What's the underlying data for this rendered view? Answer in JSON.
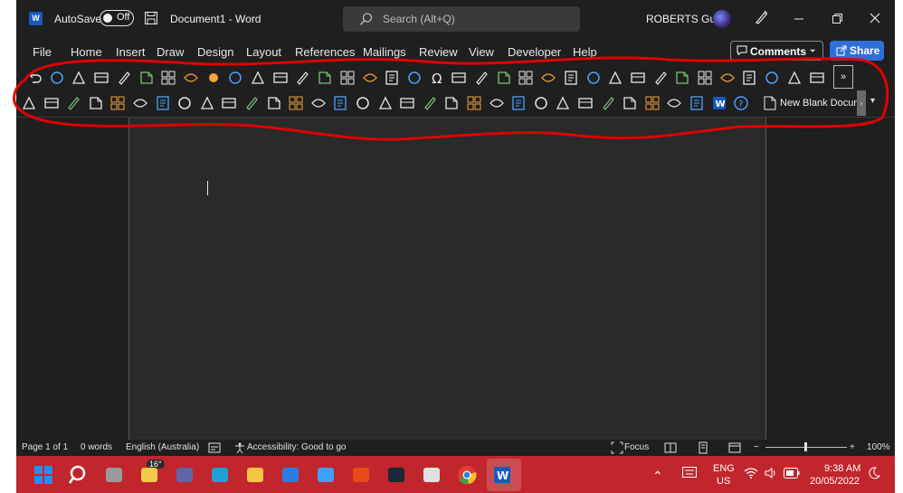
{
  "title_bar": {
    "app_logo_letter": "W",
    "autosave_label": "AutoSave",
    "autosave_state": "Off",
    "document_title": "Document1 - Word",
    "search_placeholder": "Search (Alt+Q)",
    "user_name": "ROBERTS Guy"
  },
  "ribbon_tabs": [
    "File",
    "Home",
    "Insert",
    "Draw",
    "Design",
    "Layout",
    "References",
    "Mailings",
    "Review",
    "View",
    "Developer",
    "Help"
  ],
  "comments_label": "Comments",
  "share_label": "Share",
  "toolbar": {
    "row1_icons": [
      "undo-icon",
      "paste-icon",
      "font-color-icon",
      "align-icon",
      "format-painter-icon",
      "find-icon",
      "dictate-icon",
      "ink-pen-icon",
      "record-dot-icon",
      "new-document-icon",
      "table-icon",
      "shapes-icon",
      "lasso-icon",
      "circle-icon",
      "link-icon",
      "comment-icon",
      "clipboard-icon",
      "send-icon",
      "omega-symbol-icon",
      "history-icon",
      "touch-mode-icon",
      "text-effects-icon",
      "picture-icon",
      "replay-icon",
      "text-style-icon",
      "paste-special-icon",
      "document-copy-icon",
      "indent-icon",
      "layers-icon",
      "page-icon",
      "replace-icon",
      "cube-icon",
      "editor-check-icon",
      "image-icon",
      "page-add-icon",
      "scroll-icon"
    ],
    "expand_label": "»",
    "row2_icons": [
      "spelling-icon",
      "mail-icon",
      "copy-doc-icon",
      "document-icon",
      "strikethrough-abc-icon",
      "copy-icon",
      "spell-check-icon",
      "read-aloud-icon",
      "document-x-icon",
      "info-doc-icon",
      "comment-edit-icon",
      "doc-edit-icon",
      "doc-delete-icon",
      "multi-page-icon",
      "doc-lock-icon",
      "highlighter-icon",
      "doc-lock-blue-icon",
      "record-circle-icon",
      "list-doc-icon",
      "speaker-doc-icon",
      "keyboard-icon",
      "line-spacing-icon",
      "settings-doc-icon",
      "zoom-icon",
      "insert-box-icon",
      "form-icon",
      "blue-circle-icon",
      "form-red-icon",
      "doc-protect-icon",
      "camera-doc-icon",
      "window-icon",
      "word-app-icon",
      "help-icon"
    ],
    "new_blank_document": "New Blank Document"
  },
  "status_bar": {
    "page": "Page 1 of 1",
    "words": "0 words",
    "language": "English (Australia)",
    "accessibility": "Accessibility: Good to go",
    "focus": "Focus",
    "zoom": "100%",
    "zoom_minus": "−",
    "zoom_plus": "+"
  },
  "taskbar": {
    "weather_temp": "16°",
    "apps": [
      "windows-start-icon",
      "search-icon",
      "task-view-icon",
      "weather-icon",
      "teams-icon",
      "edge-icon",
      "file-explorer-icon",
      "mail-icon",
      "store-icon",
      "office-icon",
      "steam-icon",
      "snip-icon",
      "chrome-icon",
      "word-taskbar-icon"
    ],
    "lang_line1": "ENG",
    "lang_line2": "US",
    "time": "9:38 AM",
    "date": "20/05/2022"
  },
  "colors": {
    "window_bg": "#1f1f1f",
    "page_bg": "#2a2a2a",
    "share_blue": "#2f6fd6",
    "taskbar_red": "#c0262c",
    "annotation_red": "#e00000"
  }
}
